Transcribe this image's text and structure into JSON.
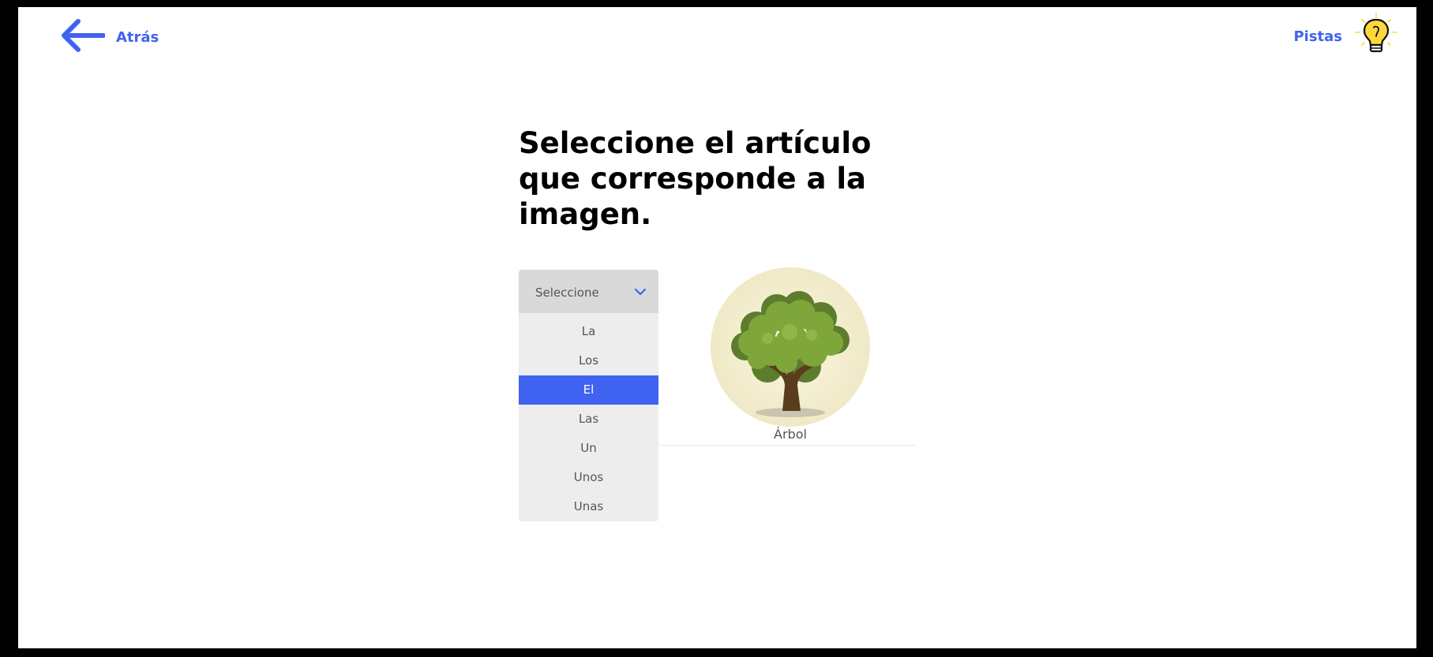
{
  "nav": {
    "back_label": "Atrás",
    "hints_label": "Pistas"
  },
  "exercise": {
    "title": "Seleccione el artículo que corresponde a la imagen.",
    "select_placeholder": "Seleccione",
    "options": [
      "La",
      "Los",
      "El",
      "Las",
      "Un",
      "Unos",
      "Unas"
    ],
    "highlighted_option": "El",
    "picture_icon": "tree-icon",
    "word": "Árbol"
  },
  "colors": {
    "accent": "#3f63f0",
    "select_bg": "#d9d9d9",
    "options_bg": "#ededed",
    "bulb": "#ffd93b"
  }
}
